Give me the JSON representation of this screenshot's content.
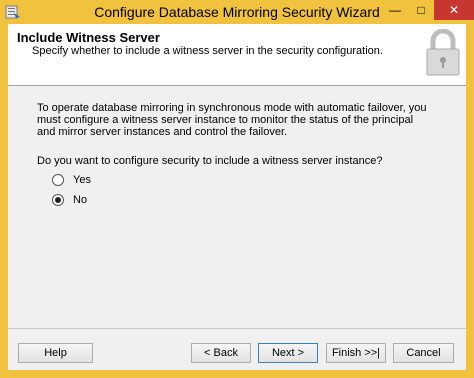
{
  "window": {
    "title": "Configure Database Mirroring Security Wizard",
    "minimize": "—",
    "maximize": "□",
    "close": "✕"
  },
  "header": {
    "title": "Include Witness Server",
    "subtitle": "Specify whether to include a witness server in the security configuration."
  },
  "body": {
    "info": "To operate database mirroring in synchronous mode with automatic failover, you must configure a witness server instance to monitor the status of the principal and mirror server instances and control the failover.",
    "question": "Do you want to configure security to include a witness server instance?",
    "options": [
      {
        "label": "Yes",
        "selected": false
      },
      {
        "label": "No",
        "selected": true
      }
    ]
  },
  "buttons": {
    "help": "Help",
    "back": "< Back",
    "next": "Next >",
    "finish": "Finish >>|",
    "cancel": "Cancel"
  },
  "icons": {
    "app": "database-wizard-icon",
    "header": "lock-icon"
  }
}
